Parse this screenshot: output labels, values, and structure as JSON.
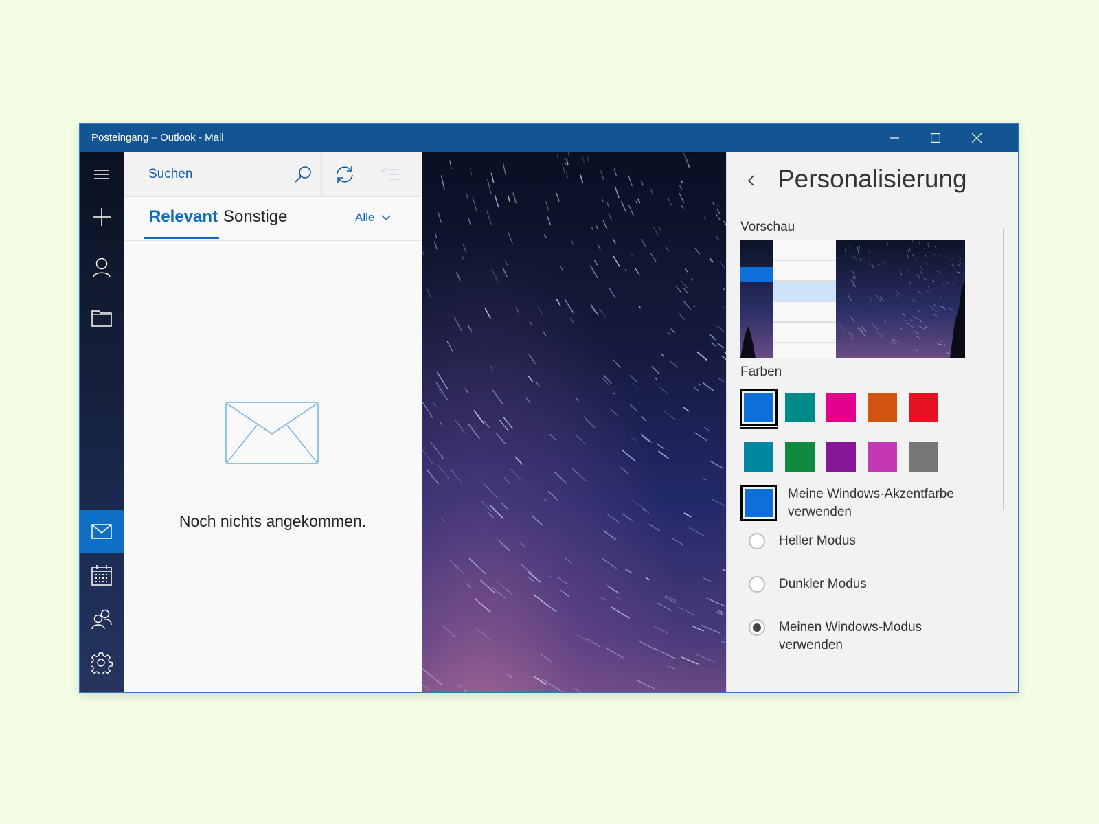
{
  "window": {
    "title": "Posteingang – Outlook - Mail",
    "accent_color": "#135592"
  },
  "rail": {
    "items": [
      {
        "name": "hamburger-menu-icon"
      },
      {
        "name": "new-mail-icon"
      },
      {
        "name": "account-icon"
      },
      {
        "name": "folders-icon"
      },
      {
        "name": "mail-icon",
        "active": true
      },
      {
        "name": "calendar-icon"
      },
      {
        "name": "people-icon"
      },
      {
        "name": "settings-gear-icon"
      }
    ],
    "active_color": "#0f6fc6"
  },
  "list": {
    "search_placeholder": "Suchen",
    "tabs": [
      {
        "label": "Relevant",
        "active": true
      },
      {
        "label": "Sonstige",
        "active": false
      }
    ],
    "filter_label": "Alle",
    "empty_message": "Noch nichts angekommen."
  },
  "panel": {
    "title": "Personalisierung",
    "preview_label": "Vorschau",
    "colors_label": "Farben",
    "colors": [
      "#0f6fd8",
      "#008b8b",
      "#e3008c",
      "#d15511",
      "#e81123",
      "#0088a3",
      "#0f8a3f",
      "#881798",
      "#c239b3",
      "#767676"
    ],
    "selected_color_index": 0,
    "accent_option_label": "Meine Windows-Akzentfarbe verwenden",
    "modes": [
      {
        "label": "Heller Modus",
        "checked": false
      },
      {
        "label": "Dunkler Modus",
        "checked": false
      },
      {
        "label": "Meinen Windows-Modus verwenden",
        "checked": true
      }
    ]
  }
}
